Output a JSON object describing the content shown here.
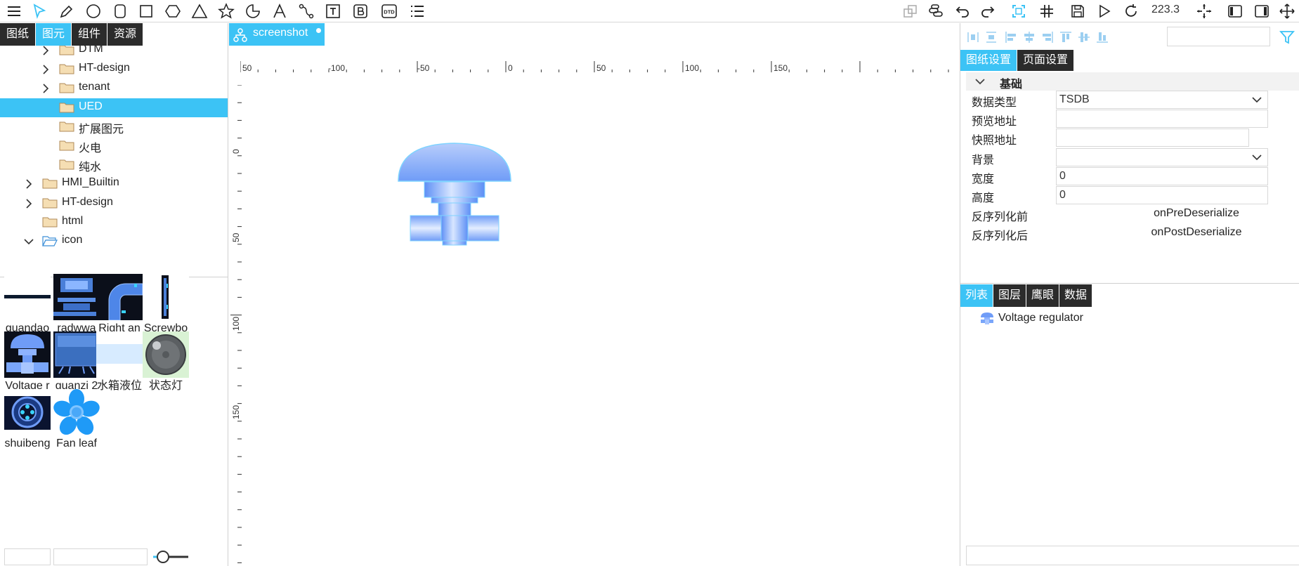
{
  "toolbar": {
    "zoom": "223.3",
    "left_tools": [
      "menu-icon",
      "pointer-icon",
      "pen-icon",
      "circle-icon",
      "rounded-rect-icon",
      "rect-icon",
      "hexagon-icon",
      "triangle-icon",
      "star-icon",
      "arc-icon",
      "text-a-icon",
      "polyline-icon",
      "text-box-icon",
      "bold-b-icon",
      "dtd-icon",
      "list-icon"
    ],
    "right_tools": [
      "layers-icon",
      "link-icon",
      "undo-icon",
      "redo-icon",
      "fit-icon",
      "grid-icon",
      "save-icon",
      "play-icon",
      "refresh-icon"
    ],
    "far_right_tools": [
      "crosshair-icon",
      "panel-left-icon",
      "panel-right-icon",
      "move-icon"
    ],
    "dtd_label": "DTD"
  },
  "left_tabs": [
    {
      "label": "图纸",
      "active": false
    },
    {
      "label": "图元",
      "active": true
    },
    {
      "label": "组件",
      "active": false
    },
    {
      "label": "资源",
      "active": false
    }
  ],
  "tree": [
    {
      "label": "DTM",
      "level": 2,
      "chevron": "right",
      "open": false,
      "selected": false
    },
    {
      "label": "HT-design",
      "level": 2,
      "chevron": "right",
      "open": false,
      "selected": false
    },
    {
      "label": "tenant",
      "level": 2,
      "chevron": "right",
      "open": false,
      "selected": false
    },
    {
      "label": "UED",
      "level": 2,
      "chevron": "none",
      "open": false,
      "selected": true
    },
    {
      "label": "扩展图元",
      "level": 2,
      "chevron": "none",
      "open": false,
      "selected": false
    },
    {
      "label": "火电",
      "level": 2,
      "chevron": "none",
      "open": false,
      "selected": false
    },
    {
      "label": "纯水",
      "level": 2,
      "chevron": "none",
      "open": false,
      "selected": false
    },
    {
      "label": "HMI_Builtin",
      "level": 1,
      "chevron": "right",
      "open": false,
      "selected": false
    },
    {
      "label": "HT-design",
      "level": 1,
      "chevron": "right",
      "open": false,
      "selected": false
    },
    {
      "label": "html",
      "level": 1,
      "chevron": "none",
      "open": false,
      "selected": false
    },
    {
      "label": "icon",
      "level": 1,
      "chevron": "down",
      "open": true,
      "selected": false
    }
  ],
  "assets": [
    {
      "name": "guandao",
      "thumb": "pipe-line"
    },
    {
      "name": "radwwa",
      "thumb": "radwwa"
    },
    {
      "name": "Right an",
      "thumb": "right-angle-pipe"
    },
    {
      "name": "Screwbo",
      "thumb": "screw-bolt"
    },
    {
      "name": "Voltage r",
      "thumb": "voltage-regulator"
    },
    {
      "name": "guanzi 2",
      "thumb": "guanzi"
    },
    {
      "name": "水箱液位",
      "thumb": "tank-level"
    },
    {
      "name": "状态灯",
      "thumb": "status-light"
    },
    {
      "name": "shuibeng",
      "thumb": "water-pump"
    },
    {
      "name": "Fan leaf",
      "thumb": "fan-leaf"
    }
  ],
  "document_tab": {
    "label": "screenshot"
  },
  "ruler": {
    "h_labels": [
      "50",
      "-100",
      "-50",
      "0",
      "50",
      "100",
      "150"
    ],
    "v_labels": [
      "0",
      "50",
      "100",
      "150"
    ]
  },
  "right_tabs": [
    {
      "label": "图纸设置",
      "active": true
    },
    {
      "label": "页面设置",
      "active": false
    }
  ],
  "section": {
    "title": "基础"
  },
  "properties": [
    {
      "label": "数据类型",
      "value": "TSDB",
      "kind": "select"
    },
    {
      "label": "预览地址",
      "value": "",
      "kind": "input"
    },
    {
      "label": "快照地址",
      "value": "",
      "kind": "input-short"
    },
    {
      "label": "背景",
      "value": "",
      "kind": "select"
    },
    {
      "label": "宽度",
      "value": "0",
      "kind": "input"
    },
    {
      "label": "高度",
      "value": "0",
      "kind": "input"
    },
    {
      "label": "反序列化前",
      "value": "onPreDeserialize",
      "kind": "text"
    },
    {
      "label": "反序列化后",
      "value": "onPostDeserialize",
      "kind": "text"
    }
  ],
  "bottom_tabs": [
    {
      "label": "列表",
      "active": true
    },
    {
      "label": "图层",
      "active": false
    },
    {
      "label": "鹰眼",
      "active": false
    },
    {
      "label": "数据",
      "active": false
    }
  ],
  "list_items": [
    {
      "label": "Voltage regulator"
    }
  ],
  "colors": {
    "accent": "#3cc3f5",
    "tab_dark": "#2b2b2b",
    "selection": "#3cc3f5",
    "folder": "#f5deb3"
  }
}
